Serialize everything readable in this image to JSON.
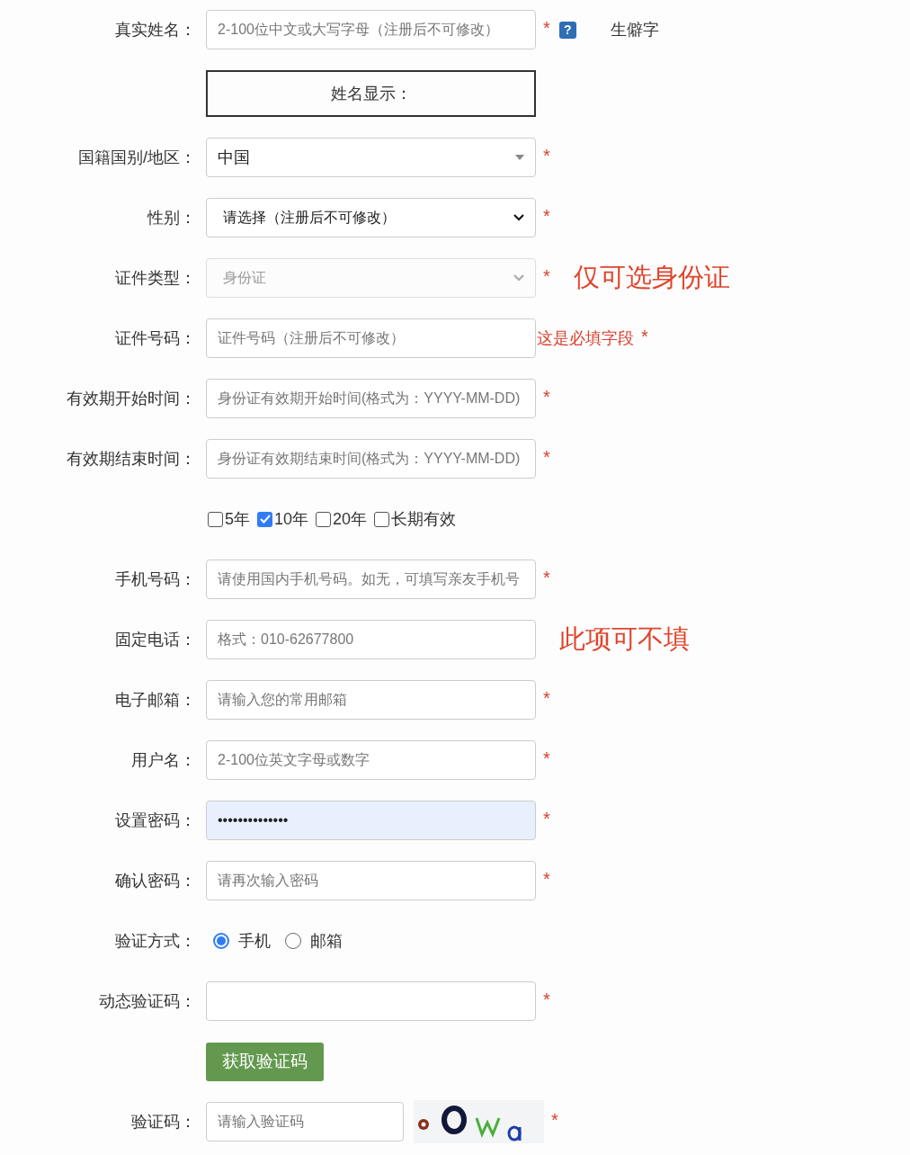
{
  "rows": [
    {
      "kind": "text",
      "label": "真实姓名：",
      "placeholder": "2-100位中文或大写字母（注册后不可修改）",
      "required_mark": "*",
      "help": "?",
      "aside": {
        "kind": "plain",
        "text": "生僻字"
      }
    },
    {
      "kind": "display",
      "value": "姓名显示："
    },
    {
      "kind": "combobox",
      "label": "国籍国别/地区：",
      "value": "中国",
      "disabled": false,
      "required_mark": "*"
    },
    {
      "kind": "select",
      "label": "性别：",
      "value": "请选择（注册后不可修改）",
      "disabled": false,
      "required_mark": "*"
    },
    {
      "kind": "select",
      "label": "证件类型：",
      "value": "身份证",
      "disabled": true,
      "required_mark": "*",
      "aside": {
        "kind": "note",
        "text": "仅可选身份证"
      }
    },
    {
      "kind": "text",
      "label": "证件号码：",
      "placeholder": "证件号码（注册后不可修改）",
      "error": "这是必填字段",
      "required_mark": "*"
    },
    {
      "kind": "text",
      "label": "有效期开始时间：",
      "placeholder": "身份证有效期开始时间(格式为：YYYY-MM-DD)",
      "required_mark": "*"
    },
    {
      "kind": "text",
      "label": "有效期结束时间：",
      "placeholder": "身份证有效期结束时间(格式为：YYYY-MM-DD)",
      "required_mark": "*"
    },
    {
      "kind": "checks",
      "options": [
        {
          "label": "5年",
          "checked": false
        },
        {
          "label": "10年",
          "checked": true
        },
        {
          "label": "20年",
          "checked": false
        },
        {
          "label": "长期有效",
          "checked": false
        }
      ]
    },
    {
      "kind": "text",
      "label": "手机号码：",
      "placeholder": "请使用国内手机号码。如无，可填写亲友手机号",
      "required_mark": "*"
    },
    {
      "kind": "text",
      "label": "固定电话：",
      "placeholder": "格式：010-62677800",
      "aside": {
        "kind": "note",
        "text": "此项可不填"
      }
    },
    {
      "kind": "text",
      "label": "电子邮箱：",
      "placeholder": "请输入您的常用邮箱",
      "required_mark": "*"
    },
    {
      "kind": "text",
      "label": "用户名：",
      "placeholder": "2-100位英文字母或数字",
      "required_mark": "*"
    },
    {
      "kind": "password",
      "label": "设置密码：",
      "value": "••••••••••••••",
      "required_mark": "*"
    },
    {
      "kind": "text",
      "label": "确认密码：",
      "placeholder": "请再次输入密码",
      "required_mark": "*"
    },
    {
      "kind": "radios",
      "label": "验证方式：",
      "options": [
        {
          "label": "手机",
          "selected": true
        },
        {
          "label": "邮箱",
          "selected": false
        }
      ]
    },
    {
      "kind": "text",
      "label": "动态验证码：",
      "required_mark": "*"
    },
    {
      "kind": "button",
      "value": "获取验证码"
    },
    {
      "kind": "captcha",
      "label": "验证码：",
      "placeholder": "请输入验证码",
      "required_mark": "*"
    }
  ]
}
